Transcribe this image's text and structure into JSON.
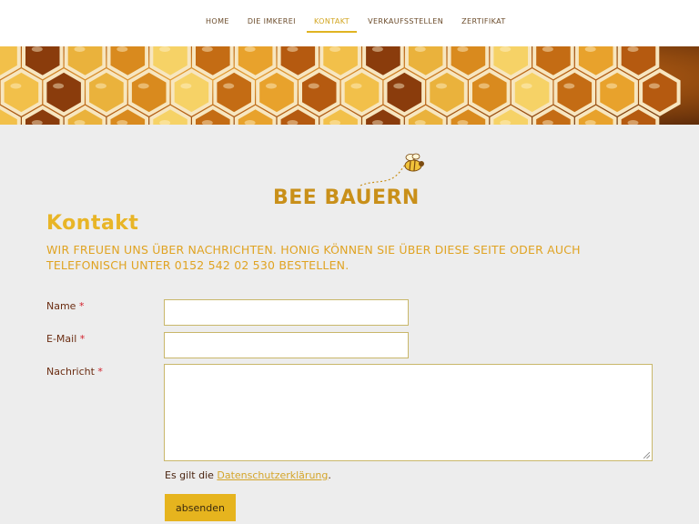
{
  "nav": {
    "items": [
      {
        "label": "HOME",
        "active": false
      },
      {
        "label": "DIE IMKEREI",
        "active": false
      },
      {
        "label": "KONTAKT",
        "active": true
      },
      {
        "label": "VERKAUFSSTELLEN",
        "active": false
      },
      {
        "label": "ZERTIFIKAT",
        "active": false
      }
    ]
  },
  "banner": {
    "icon": "honeycomb-photo"
  },
  "logo": {
    "text": "BEE BAUERN",
    "icon": "bee-icon"
  },
  "page": {
    "title": "Kontakt",
    "intro": "Wir freuen uns über Nachrichten. Honig können Sie über diese Seite oder auch telefonisch unter 0152 542 02 530 bestellen."
  },
  "form": {
    "name_label": "Name",
    "email_label": "E-Mail",
    "message_label": "Nachricht",
    "required_mark": "*",
    "name_value": "",
    "email_value": "",
    "message_value": "",
    "privacy_prefix": "Es gilt die",
    "privacy_link": "Datenschutzerklärung",
    "privacy_suffix": ".",
    "submit_label": "absenden"
  },
  "colors": {
    "accent": "#e6b41e",
    "nav_active": "#d2a520",
    "heading": "#e8b527",
    "label": "#6b2d12",
    "required": "#d21e2a",
    "background": "#ededed"
  }
}
